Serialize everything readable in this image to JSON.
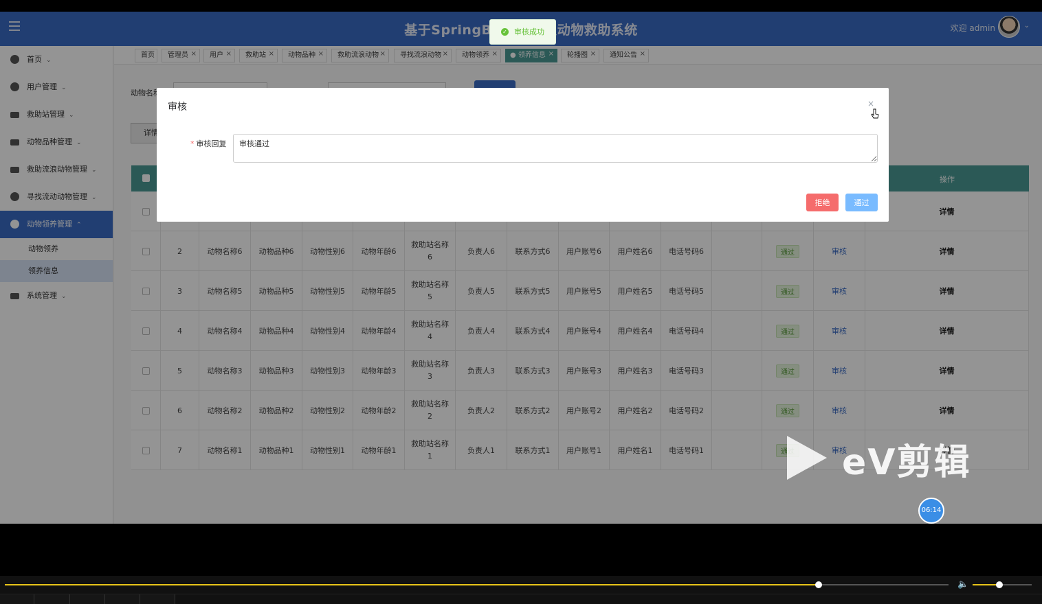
{
  "header": {
    "title": "基于SpringBoot的流浪动物救助系统",
    "welcome": "欢迎 admin"
  },
  "sidebar": {
    "items": [
      {
        "label": "首页"
      },
      {
        "label": "用户管理"
      },
      {
        "label": "救助站管理"
      },
      {
        "label": "动物品种管理"
      },
      {
        "label": "救助流浪动物管理"
      },
      {
        "label": "寻找流动动物管理"
      },
      {
        "label": "动物领养管理"
      },
      {
        "label": "系统管理"
      }
    ],
    "submenu": [
      {
        "label": "动物领养"
      },
      {
        "label": "领养信息"
      }
    ]
  },
  "tabs": [
    {
      "label": "首页"
    },
    {
      "label": "管理员"
    },
    {
      "label": "用户"
    },
    {
      "label": "救助站"
    },
    {
      "label": "动物品种"
    },
    {
      "label": "救助流浪动物"
    },
    {
      "label": "寻找流浪动物"
    },
    {
      "label": "动物领养"
    },
    {
      "label": "● 领养信息"
    },
    {
      "label": "轮播图"
    },
    {
      "label": "通知公告"
    }
  ],
  "search": {
    "label": "动物名称",
    "detail_button": "详情"
  },
  "table": {
    "op_header": "操作",
    "rows": [
      {
        "idx": "",
        "name": "",
        "breed": "",
        "gender": "",
        "age": "",
        "station": "",
        "station_no": "",
        "owner": "",
        "contact": "",
        "account": "",
        "username": "",
        "phone": "",
        "status": "",
        "audit": "",
        "detail": "详情"
      },
      {
        "idx": "2",
        "name": "动物名称6",
        "breed": "动物品种6",
        "gender": "动物性别6",
        "age": "动物年龄6",
        "station": "救助站名称",
        "station_no": "6",
        "owner": "负责人6",
        "contact": "联系方式6",
        "account": "用户账号6",
        "username": "用户姓名6",
        "phone": "电话号码6",
        "status": "通过",
        "audit": "审核",
        "detail": "详情"
      },
      {
        "idx": "3",
        "name": "动物名称5",
        "breed": "动物品种5",
        "gender": "动物性别5",
        "age": "动物年龄5",
        "station": "救助站名称",
        "station_no": "5",
        "owner": "负责人5",
        "contact": "联系方式5",
        "account": "用户账号5",
        "username": "用户姓名5",
        "phone": "电话号码5",
        "status": "通过",
        "audit": "审核",
        "detail": "详情"
      },
      {
        "idx": "4",
        "name": "动物名称4",
        "breed": "动物品种4",
        "gender": "动物性别4",
        "age": "动物年龄4",
        "station": "救助站名称",
        "station_no": "4",
        "owner": "负责人4",
        "contact": "联系方式4",
        "account": "用户账号4",
        "username": "用户姓名4",
        "phone": "电话号码4",
        "status": "通过",
        "audit": "审核",
        "detail": "详情"
      },
      {
        "idx": "5",
        "name": "动物名称3",
        "breed": "动物品种3",
        "gender": "动物性别3",
        "age": "动物年龄3",
        "station": "救助站名称",
        "station_no": "3",
        "owner": "负责人3",
        "contact": "联系方式3",
        "account": "用户账号3",
        "username": "用户姓名3",
        "phone": "电话号码3",
        "status": "通过",
        "audit": "审核",
        "detail": "详情"
      },
      {
        "idx": "6",
        "name": "动物名称2",
        "breed": "动物品种2",
        "gender": "动物性别2",
        "age": "动物年龄2",
        "station": "救助站名称",
        "station_no": "2",
        "owner": "负责人2",
        "contact": "联系方式2",
        "account": "用户账号2",
        "username": "用户姓名2",
        "phone": "电话号码2",
        "status": "通过",
        "audit": "审核",
        "detail": "详情"
      },
      {
        "idx": "7",
        "name": "动物名称1",
        "breed": "动物品种1",
        "gender": "动物性别1",
        "age": "动物年龄1",
        "station": "救助站名称",
        "station_no": "1",
        "owner": "负责人1",
        "contact": "联系方式1",
        "account": "用户账号1",
        "username": "用户姓名1",
        "phone": "电话号码1",
        "status": "通过",
        "audit": "审核",
        "detail": "详情"
      }
    ]
  },
  "toast": {
    "message": "审核成功"
  },
  "dialog": {
    "title": "审核",
    "close": "×",
    "field_label": "审核回复",
    "field_value": "审核通过",
    "reject_label": "拒绝",
    "pass_label": "通过"
  },
  "overlay_extras": {
    "watermark": "eV剪辑",
    "timer": "06:14"
  },
  "player": {
    "progress": 0.862,
    "volume": 0.45
  },
  "colors": {
    "header_blue": "#3a6bc4",
    "table_header_teal": "#4a9a94",
    "reject_red": "#f56c6c",
    "pass_blue": "#79bbff",
    "success_green": "#67c23a",
    "seek_yellow": "#e7c419"
  }
}
